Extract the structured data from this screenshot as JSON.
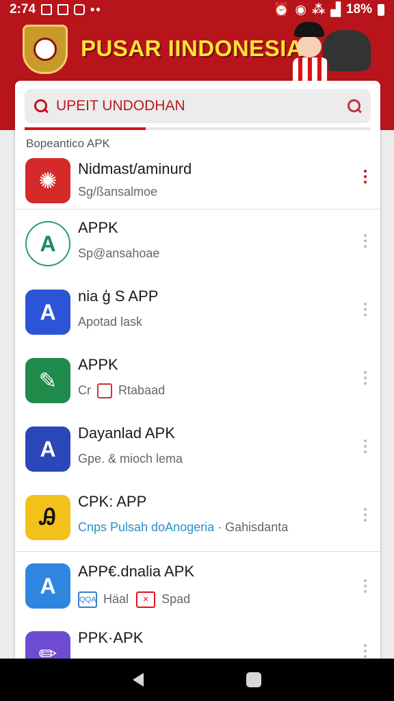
{
  "status": {
    "time": "2:74",
    "battery": "18%",
    "left_icons": [
      "image-icon",
      "calendar-icon",
      "lock-icon",
      "more-dots-icon"
    ],
    "right_icons": [
      "alarm-icon",
      "wifi-icon",
      "vibrate-icon",
      "signal-icon",
      "battery-icon"
    ]
  },
  "header": {
    "title": "PUSAR IINDONESIA",
    "colors": {
      "background": "#b8141b",
      "title": "#ffe23a"
    }
  },
  "search": {
    "value": "UPEIT UNDODHAN",
    "progress_fraction": 0.35
  },
  "section_label": "Bopeantico APK",
  "apps": [
    {
      "title": "Nidmast/aminurd",
      "subtitle": "Sg/ßansalmoe",
      "icon": "red-logo-icon",
      "color": "#d42a2a"
    },
    {
      "title": "APPK",
      "subtitle": "Sp@ansahoae",
      "icon": "green-a-circle-icon",
      "color": "#ffffff"
    },
    {
      "title": "nia ģ S APP",
      "subtitle": "Apotad lask",
      "icon": "blue-a-icon",
      "color": "#2b54d6"
    },
    {
      "title": "APPK",
      "subtitle_prefix": "Cr",
      "subtitle": "Rtabaad",
      "icon": "green-pen-icon",
      "color": "#1f8a4a"
    },
    {
      "title": "Dayanlad APK",
      "subtitle": "Gpe. & mioch lema",
      "icon": "navy-a-icon",
      "color": "#2a46b8"
    },
    {
      "title": "CPK: APP",
      "subtitle": "Cnps Pulsah doAnogeria",
      "subtitle_tail": "· Gahisdanta",
      "icon": "yellow-scribble-icon",
      "color": "#f3c21a"
    },
    {
      "title": "APP€.dnalia APK",
      "badge_left": "QQA",
      "subtitle": "Häal",
      "subtitle_tail": "Spad",
      "icon": "blue-a-doc-icon",
      "color": "#2f86e0"
    },
    {
      "title": "PPK·APK",
      "subtitle": "",
      "icon": "purple-pencil-icon",
      "color": "#6e4bd1"
    }
  ]
}
